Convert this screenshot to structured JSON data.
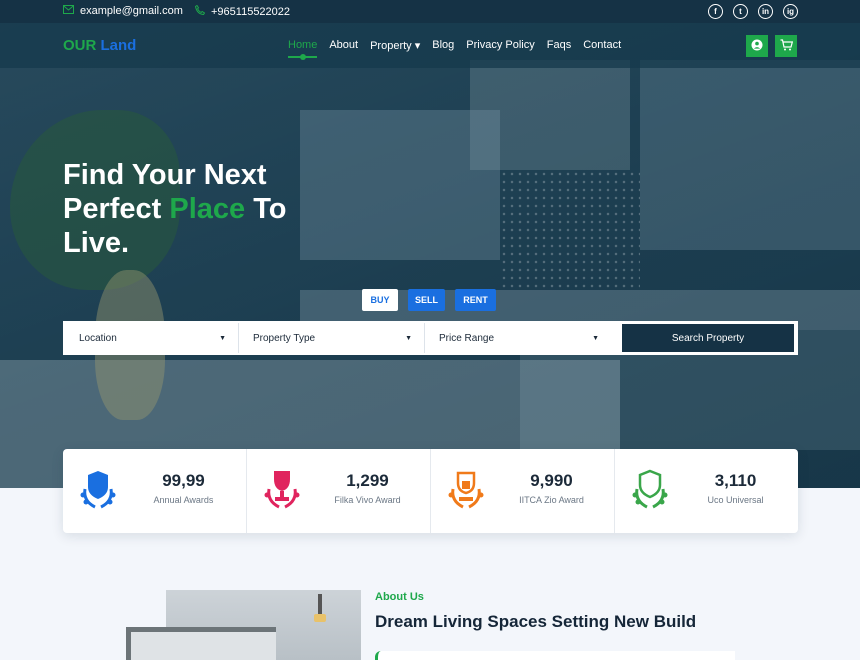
{
  "topbar": {
    "email": "example@gmail.com",
    "phone": "+965115522022",
    "socials": [
      "f",
      "t",
      "in",
      "ig"
    ]
  },
  "brand": {
    "part1": "OUR",
    "part2": "Land"
  },
  "nav": {
    "items": [
      {
        "label": "Home",
        "active": true
      },
      {
        "label": "About"
      },
      {
        "label": "Property ▾"
      },
      {
        "label": "Blog"
      },
      {
        "label": "Privacy Policy"
      },
      {
        "label": "Faqs"
      },
      {
        "label": "Contact"
      }
    ]
  },
  "hero": {
    "line1": "Find Your Next",
    "line2a": "Perfect",
    "line2b": "Place",
    "line2c": "To",
    "line3": "Live."
  },
  "tabs": {
    "buy": "BUY",
    "sell": "SELL",
    "rent": "RENT"
  },
  "search": {
    "location": "Location",
    "property_type": "Property Type",
    "price_range": "Price Range",
    "button": "Search Property"
  },
  "stats": [
    {
      "value": "99,99",
      "label": "Annual Awards",
      "color": "#1a6fe0"
    },
    {
      "value": "1,299",
      "label": "Filka Vivo Award",
      "color": "#e0245e"
    },
    {
      "value": "9,990",
      "label": "IITCA Zio Award",
      "color": "#f07a1a"
    },
    {
      "value": "3,110",
      "label": "Uco Universal",
      "color": "#3aa64a"
    }
  ],
  "about": {
    "tag": "About Us",
    "title": "Dream Living Spaces Setting New Build"
  },
  "colors": {
    "accent": "#1ea84b",
    "brand_blue": "#1a6fe0",
    "dark": "#153245"
  }
}
